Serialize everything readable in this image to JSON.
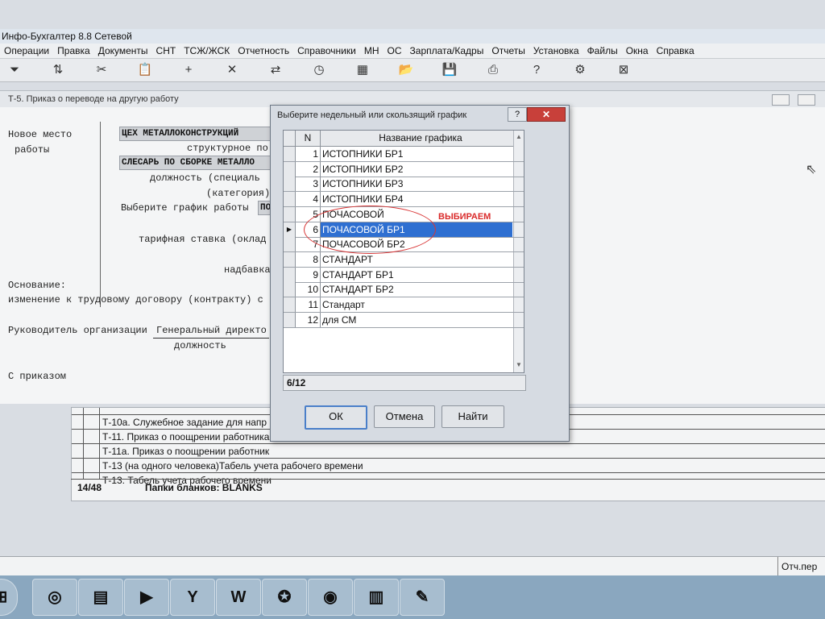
{
  "app": {
    "title": "Инфо-Бухгалтер 8.8 Сетевой"
  },
  "menu": [
    "Операции",
    "Правка",
    "Документы",
    "СНТ",
    "ТСЖ/ЖСК",
    "Отчетность",
    "Справочники",
    "МН",
    "ОС",
    "Зарплата/Кадры",
    "Отчеты",
    "Установка",
    "Файлы",
    "Окна",
    "Справка"
  ],
  "toolbar": [
    {
      "icon": "filter-icon",
      "glyph": "⏷"
    },
    {
      "icon": "sort-icon",
      "glyph": "⇅"
    },
    {
      "icon": "scissors-icon",
      "glyph": "✂"
    },
    {
      "icon": "paste-icon",
      "glyph": "📋"
    },
    {
      "icon": "add-icon",
      "glyph": "+"
    },
    {
      "icon": "delete-icon",
      "glyph": "✕"
    },
    {
      "icon": "replace-icon",
      "glyph": "⇄"
    },
    {
      "icon": "history-icon",
      "glyph": "◷"
    },
    {
      "icon": "calc-icon",
      "glyph": "▦"
    },
    {
      "icon": "folder-icon",
      "glyph": "📂"
    },
    {
      "icon": "save-icon",
      "glyph": "💾"
    },
    {
      "icon": "print-icon",
      "glyph": "⎙"
    },
    {
      "icon": "help-icon",
      "glyph": "?"
    },
    {
      "icon": "tools-icon",
      "glyph": "⚙"
    },
    {
      "icon": "exit-icon",
      "glyph": "⊠"
    }
  ],
  "document": {
    "window_title": "Т-5. Приказ о переводе на другую работу",
    "label_new_place_1": "Новое место",
    "label_new_place_2": "работы",
    "field_department": "ЦЕХ МЕТАЛЛОКОНСТРУКЦИЙ",
    "label_structural": "структурное по",
    "field_position": "СЛЕСАРЬ ПО СБОРКЕ МЕТАЛЛО",
    "label_position": "должность (специаль",
    "label_category": "(категория)",
    "label_schedule": "Выберите график работы",
    "field_schedule": "ПО",
    "label_tariff": "тарифная ставка (оклад",
    "label_bonus": "надбавка",
    "label_basis": "Основание:",
    "label_basis_text": "изменение к трудовому договору (контракту) с",
    "label_head": "Руководитель организации",
    "field_head": "Генеральный директо",
    "label_head_pos": "должность",
    "label_order": "С приказом"
  },
  "lower_list": {
    "rows": [
      "Т-10а. Служебное задание для напр",
      "Т-11. Приказ о поощрении работника",
      "Т-11а. Приказ о поощрении работник",
      "Т-13 (на одного человека)Табель учета рабочего времени",
      "Т-13. Табель учета рабочего времени"
    ],
    "count": "14/48",
    "folder_label": "Папки бланков: BLANKS"
  },
  "status_right": "Отч.пер",
  "dialog": {
    "title": "Выберите недельный или скользящий график",
    "col_n": "N",
    "col_name": "Название графика",
    "rows": [
      {
        "n": "1",
        "name": "ИСТОПНИКИ БР1"
      },
      {
        "n": "2",
        "name": "ИСТОПНИКИ БР2"
      },
      {
        "n": "3",
        "name": "ИСТОПНИКИ БР3"
      },
      {
        "n": "4",
        "name": "ИСТОПНИКИ БР4"
      },
      {
        "n": "5",
        "name": "ПОЧАСОВОЙ"
      },
      {
        "n": "6",
        "name": "ПОЧАСОВОЙ БР1"
      },
      {
        "n": "7",
        "name": "ПОЧАСОВОЙ БР2"
      },
      {
        "n": "8",
        "name": "СТАНДАРТ"
      },
      {
        "n": "9",
        "name": "СТАНДАРТ БР1"
      },
      {
        "n": "10",
        "name": "СТАНДАРТ БР2"
      },
      {
        "n": "11",
        "name": "Стандарт"
      },
      {
        "n": "12",
        "name": "для СМ"
      }
    ],
    "selected_index": 5,
    "count": "6/12",
    "ok": "ОК",
    "cancel": "Отмена",
    "find": "Найти",
    "help_btn": "?",
    "close_btn": "✕"
  },
  "annotation": "ВЫБИРАЕМ",
  "taskbar": [
    {
      "icon": "windows-icon",
      "glyph": "⊞"
    },
    {
      "icon": "alice-icon",
      "glyph": "◎"
    },
    {
      "icon": "file-manager-icon",
      "glyph": "▤"
    },
    {
      "icon": "media-icon",
      "glyph": "▶"
    },
    {
      "icon": "yandex-browser-icon",
      "glyph": "Y"
    },
    {
      "icon": "word-icon",
      "glyph": "W"
    },
    {
      "icon": "antivirus-icon",
      "glyph": "✪"
    },
    {
      "icon": "disk-icon",
      "glyph": "◉"
    },
    {
      "icon": "accounting-app-icon",
      "glyph": "▥"
    },
    {
      "icon": "paint-icon",
      "glyph": "✎"
    }
  ],
  "colors": {
    "selection": "#2e6fd1",
    "annotation": "#d92a2a",
    "taskbar": "#8aa7bf"
  }
}
